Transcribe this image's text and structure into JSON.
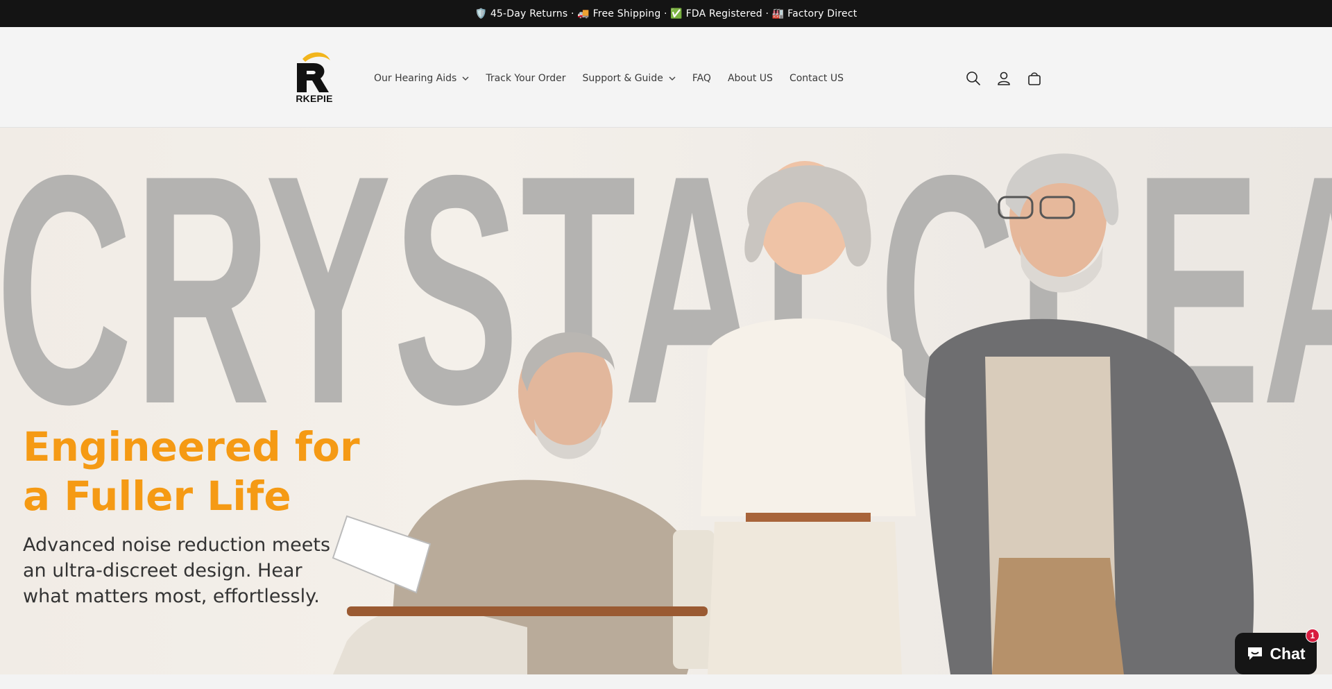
{
  "announcement": {
    "text": "🛡️ 45-Day Returns · 🚚 Free Shipping · ✅ FDA Registered · 🏭 Factory Direct"
  },
  "header": {
    "logo_text": "RKEPIE",
    "nav": [
      {
        "label": "Our Hearing Aids",
        "has_dropdown": true
      },
      {
        "label": "Track Your Order",
        "has_dropdown": false
      },
      {
        "label": "Support & Guide",
        "has_dropdown": true
      },
      {
        "label": "FAQ",
        "has_dropdown": false
      },
      {
        "label": "About US",
        "has_dropdown": false
      },
      {
        "label": "Contact US",
        "has_dropdown": false
      }
    ],
    "icons": [
      "search-icon",
      "account-icon",
      "cart-icon"
    ]
  },
  "hero": {
    "background_word": "CRYSTALCLEAR",
    "headline_line1": "Engineered for",
    "headline_line2": "a Fuller Life",
    "subcopy_line1": "Advanced noise reduction meets",
    "subcopy_line2": "an ultra-discreet design. Hear",
    "subcopy_line3": "what matters most, effortlessly."
  },
  "chat": {
    "label": "Chat",
    "badge_count": "1"
  },
  "colors": {
    "announcement_bg": "#141414",
    "headline_orange": "#f59a14",
    "logo_gold": "#f2b51c",
    "chat_badge": "#d81d3f"
  }
}
